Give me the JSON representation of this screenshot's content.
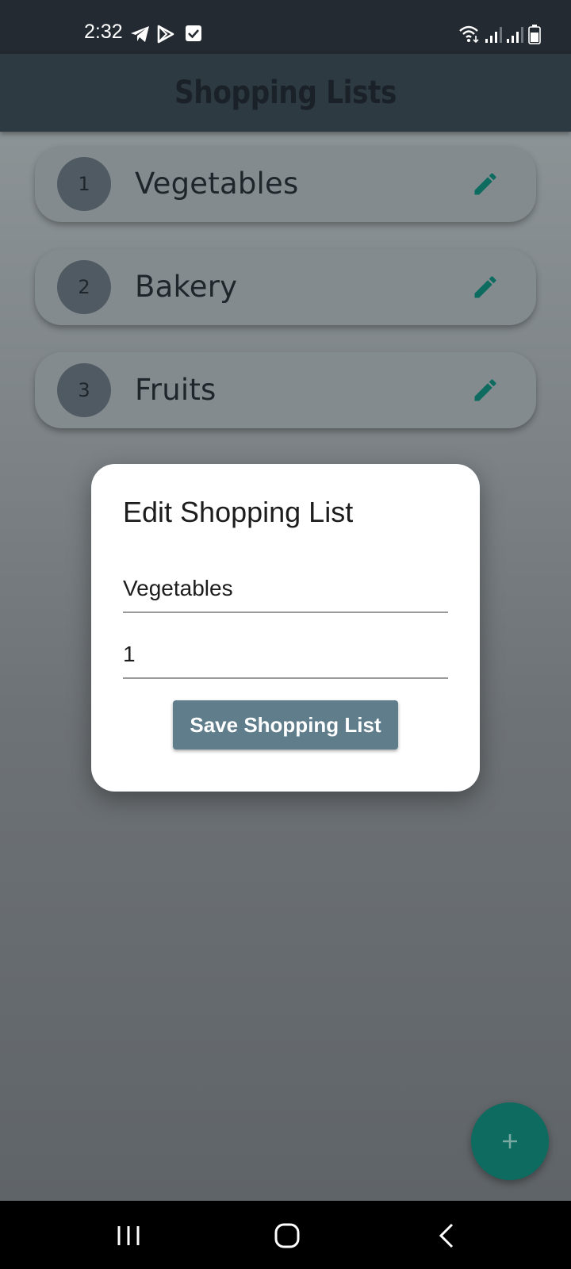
{
  "status_bar": {
    "time": "2:32",
    "notification_icons": [
      "telegram-icon",
      "play-store-icon",
      "check-box-icon"
    ],
    "system_icons": [
      "wifi-icon",
      "signal-icon",
      "signal-icon",
      "battery-icon"
    ]
  },
  "app_bar": {
    "title": "Shopping Lists"
  },
  "lists": [
    {
      "number": "1",
      "name": "Vegetables"
    },
    {
      "number": "2",
      "name": "Bakery"
    },
    {
      "number": "3",
      "name": "Fruits"
    }
  ],
  "dialog": {
    "title": "Edit Shopping List",
    "name_value": "Vegetables",
    "priority_value": "1",
    "save_label": "Save Shopping List"
  },
  "fab": {
    "icon": "plus-icon"
  },
  "nav_bar": {
    "icons": [
      "recent-apps-icon",
      "home-icon",
      "back-icon"
    ]
  },
  "colors": {
    "status_bar": "#232a31",
    "app_bar": "#2e3a42",
    "accent": "#0d6b60",
    "button": "#607d8b"
  }
}
